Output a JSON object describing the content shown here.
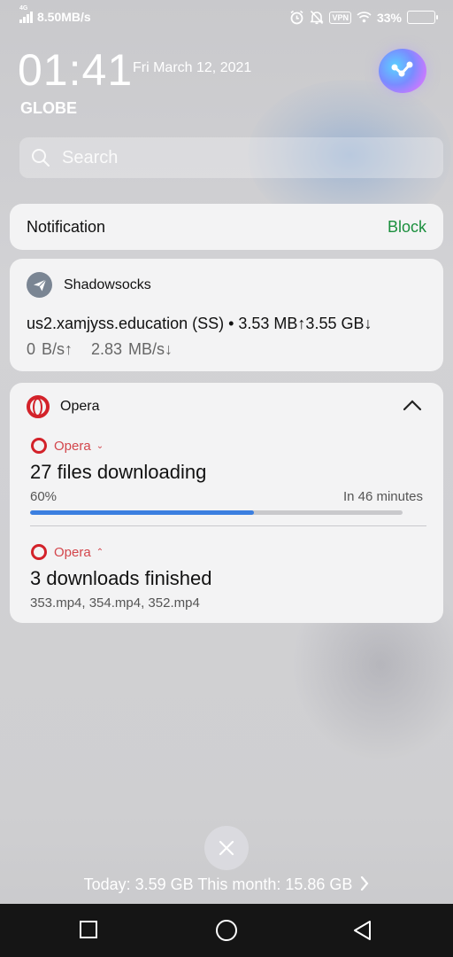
{
  "status_bar": {
    "network_type": "4G",
    "speed": "8.50MB/s",
    "vpn_label": "VPN",
    "battery_percent": "33%",
    "battery_level": 0.33,
    "icons": [
      "signal-icon",
      "alarm-icon",
      "mute-icon",
      "vpn-icon",
      "wifi-icon",
      "battery-icon"
    ]
  },
  "lockscreen": {
    "time": "01:41",
    "date": "Fri March 12, 2021",
    "carrier": "GLOBE"
  },
  "search": {
    "placeholder": "Search"
  },
  "notification_banner": {
    "label": "Notification",
    "action": "Block",
    "action_color": "#1b8f3d"
  },
  "shadowsocks": {
    "app_name": "Shadowsocks",
    "line1": "us2.xamjyss.education (SS) • 3.53 MB↑3.55 GB↓",
    "line2": "0 B/s↑   2.83 MB/s↓"
  },
  "opera": {
    "app_name": "Opera",
    "accent_color": "#d3222a",
    "downloading": {
      "app_name": "Opera",
      "title": "27 files downloading",
      "percent_label": "60%",
      "progress": 0.6,
      "eta": "In 46 minutes"
    },
    "finished": {
      "app_name": "Opera",
      "title": "3 downloads finished",
      "files": "353.mp4, 354.mp4, 352.mp4"
    }
  },
  "footer": {
    "data_usage": "Today: 3.59 GB This month: 15.86 GB"
  }
}
